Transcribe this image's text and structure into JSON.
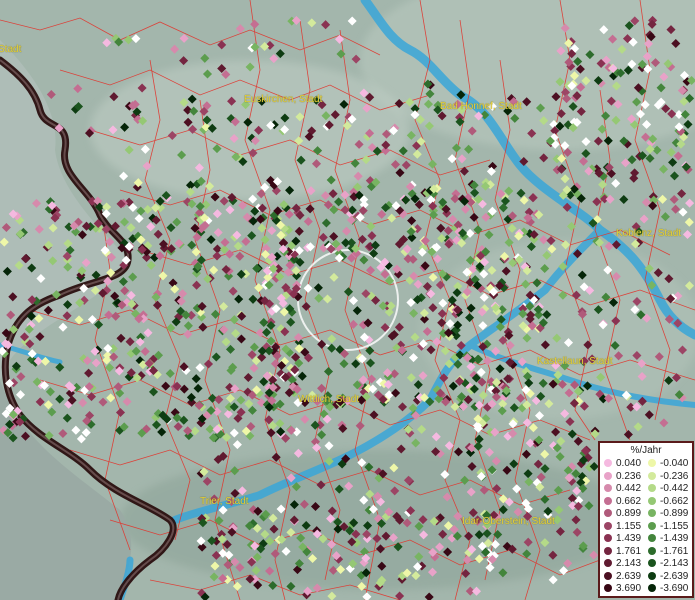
{
  "map": {
    "cities": [
      {
        "id": "euskirchen",
        "label": "Euskirchen, Stadt"
      },
      {
        "id": "bad-honnef",
        "label": "Bad Honnef, Stadt"
      },
      {
        "id": "koblenz",
        "label": "Koblenz, Stadt"
      },
      {
        "id": "kastellaun",
        "label": "Kastellaun, Stadt"
      },
      {
        "id": "wittlich",
        "label": "Wittlich, Stadt"
      },
      {
        "id": "trier",
        "label": "Trier, Stadt"
      },
      {
        "id": "idar-oberstein",
        "label": "Idar-Oberstein, Stadt"
      },
      {
        "id": "left-edge",
        "label": "Stadt"
      }
    ],
    "colors": {
      "terrain": "#9fb3a9",
      "river": "#3aa6d8",
      "border": "#e0372f",
      "country_border": "#2a0f0f"
    }
  },
  "legend": {
    "title": "%/Jahr",
    "positive": [
      {
        "value": "0.040",
        "color": "#f5b9e0"
      },
      {
        "value": "0.236",
        "color": "#e8a2c8"
      },
      {
        "value": "0.442",
        "color": "#d68aac"
      },
      {
        "value": "0.662",
        "color": "#c46e92"
      },
      {
        "value": "0.899",
        "color": "#b05a7a"
      },
      {
        "value": "1.155",
        "color": "#9c4565"
      },
      {
        "value": "1.439",
        "color": "#8a3252"
      },
      {
        "value": "1.761",
        "color": "#742540"
      },
      {
        "value": "2.143",
        "color": "#601a30"
      },
      {
        "value": "2.639",
        "color": "#4c1022"
      },
      {
        "value": "3.690",
        "color": "#380815"
      }
    ],
    "negative": [
      {
        "value": "-0.040",
        "color": "#eef7a8"
      },
      {
        "value": "-0.236",
        "color": "#d3ea9c"
      },
      {
        "value": "-0.442",
        "color": "#b4da88"
      },
      {
        "value": "-0.662",
        "color": "#95c874"
      },
      {
        "value": "-0.899",
        "color": "#78b462"
      },
      {
        "value": "-1.155",
        "color": "#5c9d4e"
      },
      {
        "value": "-1.439",
        "color": "#43853c"
      },
      {
        "value": "-1.761",
        "color": "#2d6c2c"
      },
      {
        "value": "-2.143",
        "color": "#1b541e"
      },
      {
        "value": "-2.639",
        "color": "#0e3c12"
      },
      {
        "value": "-3.690",
        "color": "#052508"
      }
    ]
  }
}
